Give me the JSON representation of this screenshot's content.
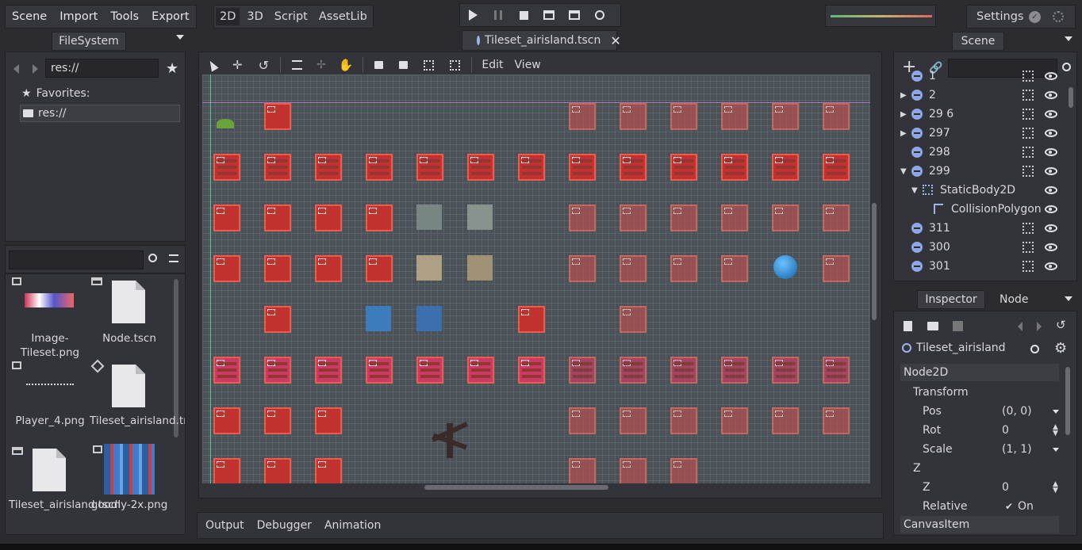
{
  "menu": {
    "items": [
      "Scene",
      "Import",
      "Tools",
      "Export"
    ]
  },
  "modes": {
    "items": [
      "2D",
      "3D",
      "Script",
      "AssetLib"
    ],
    "active": "2D"
  },
  "settings": {
    "label": "Settings"
  },
  "filesystem": {
    "tab": "FileSystem",
    "path": "res://",
    "favorites_label": "Favorites:",
    "root": "res://",
    "search_value": "",
    "files": [
      {
        "name": "Image-Tileset.png"
      },
      {
        "name": "Node.tscn"
      },
      {
        "name": "Player_4.png"
      },
      {
        "name": "Tileset_airisland.tres"
      },
      {
        "name": "Tileset_airisland.tscn"
      },
      {
        "name": "goodly-2x.png"
      }
    ]
  },
  "editor": {
    "tab_title": "Tileset_airisland.tscn",
    "menus": [
      "Edit",
      "View"
    ]
  },
  "bottom_tabs": [
    "Output",
    "Debugger",
    "Animation"
  ],
  "scene": {
    "tab": "Scene",
    "filter_value": "",
    "rows": [
      {
        "label": "1",
        "depth": 0,
        "arrow": "",
        "icon": "node",
        "group": true
      },
      {
        "label": "2",
        "depth": 0,
        "arrow": "▶",
        "icon": "node",
        "group": true
      },
      {
        "label": "29 6",
        "depth": 0,
        "arrow": "▶",
        "icon": "node",
        "group": true
      },
      {
        "label": "297",
        "depth": 0,
        "arrow": "▶",
        "icon": "node",
        "group": true
      },
      {
        "label": "298",
        "depth": 0,
        "arrow": "",
        "icon": "node",
        "group": true
      },
      {
        "label": "299",
        "depth": 0,
        "arrow": "▼",
        "icon": "node",
        "group": true
      },
      {
        "label": "StaticBody2D",
        "depth": 1,
        "arrow": "▼",
        "icon": "body",
        "group": false
      },
      {
        "label": "CollisionPolygon",
        "depth": 2,
        "arrow": "",
        "icon": "poly",
        "group": false
      },
      {
        "label": "311",
        "depth": 0,
        "arrow": "",
        "icon": "node",
        "group": true
      },
      {
        "label": "300",
        "depth": 0,
        "arrow": "",
        "icon": "node",
        "group": true
      },
      {
        "label": "301",
        "depth": 0,
        "arrow": "",
        "icon": "node",
        "group": true
      }
    ]
  },
  "inspector": {
    "tabs": [
      "Inspector",
      "Node"
    ],
    "object": "Tileset_airisland",
    "sections": {
      "node2d": "Node2D",
      "transform": "Transform",
      "z_group": "Z",
      "canvas": "CanvasItem"
    },
    "props": {
      "pos_label": "Pos",
      "pos_value": "(0, 0)",
      "rot_label": "Rot",
      "rot_value": "0",
      "scale_label": "Scale",
      "scale_value": "(1, 1)",
      "z_label": "Z",
      "z_value": "0",
      "relative_label": "Relative",
      "relative_value": "On"
    }
  },
  "colors": {
    "accent": "#9fb4ec",
    "tile": "#c9302b",
    "tile_border": "#ff5a4a",
    "background": "#2b2b30"
  }
}
